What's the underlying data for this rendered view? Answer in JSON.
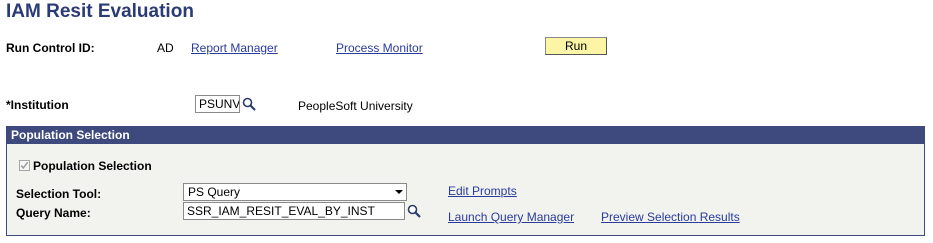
{
  "page": {
    "title": "IAM Resit Evaluation"
  },
  "run_control": {
    "label": "Run Control ID:",
    "value": "AD",
    "report_manager_link": "Report Manager",
    "process_monitor_link": "Process Monitor",
    "run_button": "Run"
  },
  "institution": {
    "label": "*Institution",
    "value": "PSUNV",
    "description": "PeopleSoft University"
  },
  "population_selection": {
    "header": "Population Selection",
    "checkbox_label": "Population Selection",
    "checkbox_checked": true,
    "checkbox_disabled": true,
    "selection_tool_label": "Selection Tool:",
    "selection_tool_value": "PS Query",
    "edit_prompts_link": "Edit Prompts",
    "query_name_label": "Query Name:",
    "query_name_value": "SSR_IAM_RESIT_EVAL_BY_INST",
    "launch_query_manager_link": "Launch Query Manager",
    "preview_selection_results_link": "Preview Selection Results"
  },
  "icons": {
    "lookup": "magnifier-lookup-icon",
    "dropdown": "chevron-down-icon",
    "check": "checkmark-icon"
  },
  "colors": {
    "title": "#2b3b76",
    "link": "#2a3b9a",
    "header_bg": "#3e4a7e",
    "run_button_bg": "#fbf5a5",
    "group_bg": "#f2f3ef"
  }
}
